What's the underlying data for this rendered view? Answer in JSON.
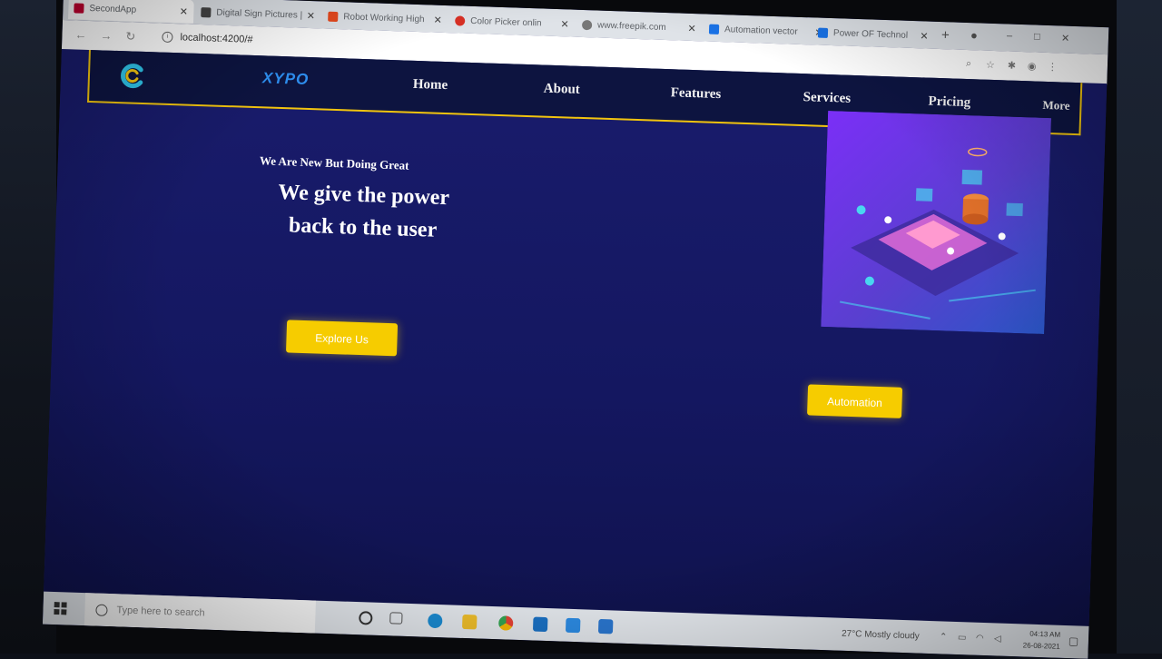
{
  "browser": {
    "tabs": [
      {
        "label": "SecondApp",
        "icon": "angular-icon",
        "color": "#c3002f"
      },
      {
        "label": "Digital Sign Pictures |",
        "icon": "image-icon",
        "color": "#444444"
      },
      {
        "label": "Robot Working High",
        "icon": "freepik-icon",
        "color": "#e8491d"
      },
      {
        "label": "Color Picker onlin",
        "icon": "color-picker-icon",
        "color": "#d93025"
      },
      {
        "label": "www.freepik.com",
        "icon": "globe-icon",
        "color": "#777777"
      },
      {
        "label": "Automation vector",
        "icon": "freepik-icon",
        "color": "#1a73e8"
      },
      {
        "label": "Power OF Technol",
        "icon": "freepik-icon",
        "color": "#1a73e8"
      }
    ],
    "url": "localhost:4200/#"
  },
  "navbar": {
    "brand": "XYPO",
    "links": [
      "Home",
      "About",
      "Features",
      "Services",
      "Pricing",
      "More"
    ]
  },
  "hero": {
    "subheading": "We Are New But Doing Great",
    "headline_line1": "We give the power",
    "headline_line2": "back to the user",
    "explore_button": "Explore Us",
    "automation_button": "Automation"
  },
  "taskbar": {
    "search_placeholder": "Type here to search",
    "weather": "27°C Mostly cloudy",
    "time": "04:13 AM",
    "date": "26-08-2021"
  },
  "colors": {
    "page_background": "#16195e",
    "navbar_background": "#0d1440",
    "navbar_border": "#f1c40f",
    "brand": "#2e8ff0",
    "button": "#f6cc00"
  }
}
